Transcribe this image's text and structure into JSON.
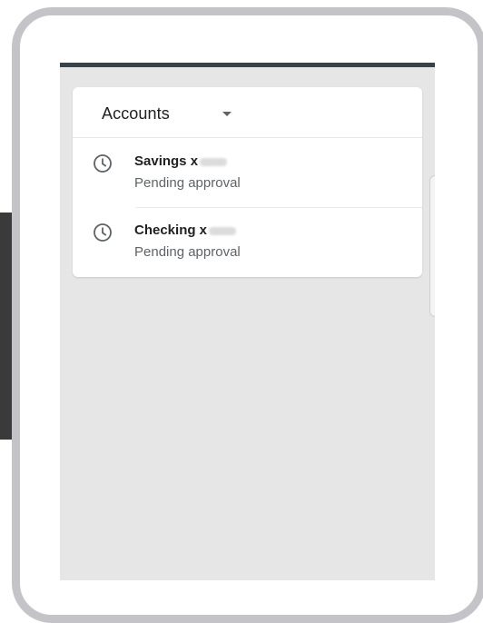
{
  "accounts_card": {
    "title": "Accounts",
    "dropdown_icon": "caret-down-icon",
    "items": [
      {
        "name": "Savings x",
        "number_masked": "blurred",
        "status": "Pending approval",
        "icon": "clock-icon"
      },
      {
        "name": "Checking x",
        "number_masked": "blurred",
        "status": "Pending approval",
        "icon": "clock-icon"
      }
    ]
  },
  "colors": {
    "status_bar": "#37424a",
    "screen_background": "#e6e6e6",
    "device_frame": "#c4c4c8",
    "card_background": "#ffffff",
    "primary_text": "#202124",
    "secondary_text": "#5f6368"
  }
}
